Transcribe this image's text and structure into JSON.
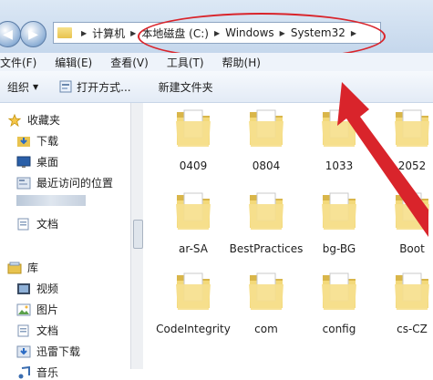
{
  "breadcrumb": [
    "计算机",
    "本地磁盘 (C:)",
    "Windows",
    "System32"
  ],
  "menu": [
    "文件(F)",
    "编辑(E)",
    "查看(V)",
    "工具(T)",
    "帮助(H)"
  ],
  "toolbar": {
    "organize": "组织",
    "open_with": "打开方式...",
    "new_folder": "新建文件夹"
  },
  "nav": {
    "favorites": "收藏夹",
    "downloads": "下载",
    "desktop": "桌面",
    "recent": "最近访问的位置",
    "documents_fav": "文档",
    "libraries": "库",
    "videos": "视频",
    "pictures": "图片",
    "documents": "文档",
    "thunder": "迅雷下载",
    "partial": "音乐"
  },
  "folders": [
    {
      "name": "0409"
    },
    {
      "name": "0804"
    },
    {
      "name": "1033"
    },
    {
      "name": "2052"
    },
    {
      "name": "ar-SA"
    },
    {
      "name": "BestPractices"
    },
    {
      "name": "bg-BG"
    },
    {
      "name": "Boot"
    },
    {
      "name": "CodeIntegrity"
    },
    {
      "name": "com"
    },
    {
      "name": "config"
    },
    {
      "name": "cs-CZ"
    }
  ],
  "colors": {
    "annotation": "#d9242b",
    "folder": "#e8c34f"
  }
}
